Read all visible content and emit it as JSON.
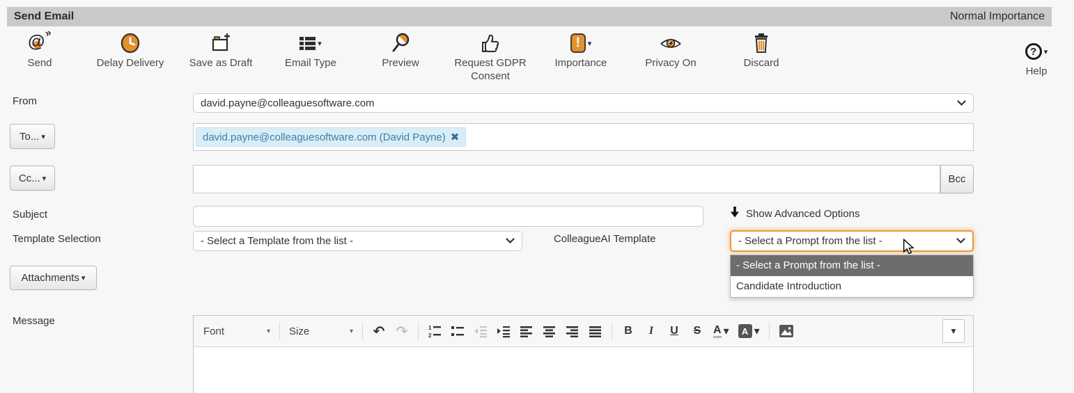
{
  "titlebar": {
    "title": "Send Email",
    "status": "Normal Importance"
  },
  "ribbon": {
    "items": [
      {
        "label": "Send",
        "icon": "send-at-icon"
      },
      {
        "label": "Delay Delivery",
        "icon": "clock-icon"
      },
      {
        "label": "Save as Draft",
        "icon": "draft-box-icon"
      },
      {
        "label": "Email Type",
        "icon": "list-icon"
      },
      {
        "label": "Preview",
        "icon": "magnifier-icon"
      },
      {
        "label": "Request GDPR Consent",
        "icon": "thumbs-up-icon"
      },
      {
        "label": "Importance",
        "icon": "exclamation-icon"
      },
      {
        "label": "Privacy On",
        "icon": "eye-icon"
      },
      {
        "label": "Discard",
        "icon": "trash-icon"
      }
    ],
    "help_label": "Help"
  },
  "form": {
    "from_label": "From",
    "from_value": "david.payne@colleaguesoftware.com",
    "to_button": "To...",
    "to_chip": "david.payne@colleaguesoftware.com (David Payne)",
    "to_chip_remove": "✖",
    "cc_button": "Cc...",
    "bcc_button": "Bcc",
    "subject_label": "Subject",
    "advanced_options_label": "Show Advanced Options",
    "template_label": "Template Selection",
    "template_value": "- Select a Template from the list -",
    "ai_label": "ColleagueAI Template",
    "ai_value": "- Select a Prompt from the list -",
    "ai_options": [
      "- Select a Prompt from the list -",
      "Candidate Introduction"
    ],
    "attachments_button": "Attachments",
    "message_label": "Message"
  },
  "editor": {
    "font_label": "Font",
    "size_label": "Size"
  },
  "colors": {
    "accent_orange": "#e0922f",
    "titlebar_bg": "#c9c9c9",
    "chip_bg": "#d9edf7",
    "chip_text": "#3e7fa6",
    "dropdown_highlight_bg": "#6d6d6d",
    "focus_glow": "#e79a3b"
  }
}
